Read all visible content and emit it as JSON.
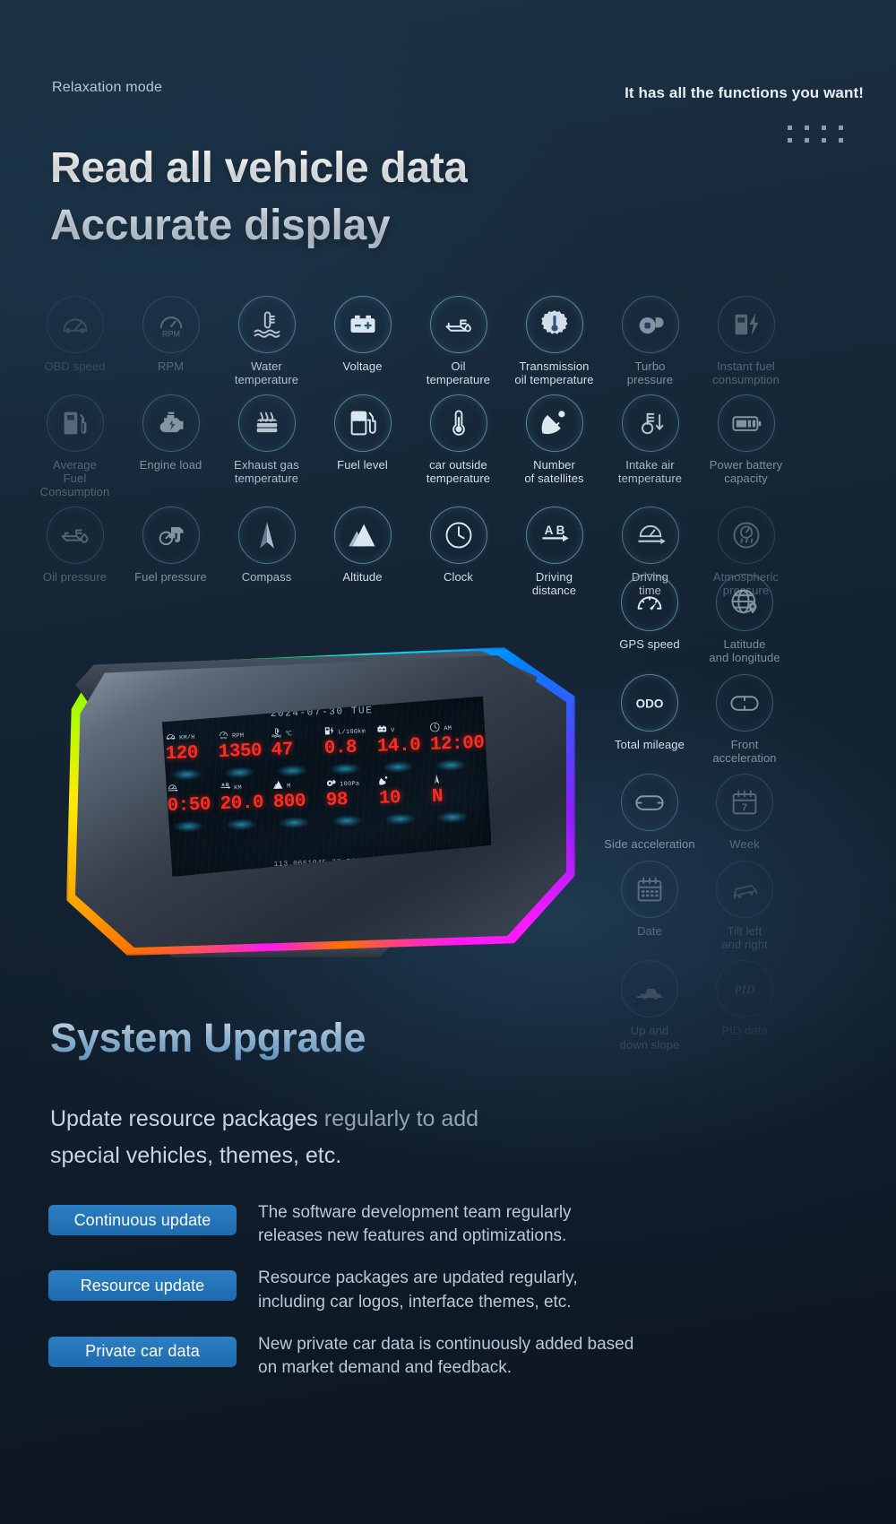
{
  "header": {
    "relaxation_mode": "Relaxation\nmode",
    "tagline": "It has all the functions you want!",
    "headline_line1": "Read all vehicle data",
    "headline_line2": "Accurate display"
  },
  "icon_grid": {
    "rows": [
      [
        {
          "label": "OBD speed",
          "icon": "speedometer-icon",
          "opacity": "op-16"
        },
        {
          "label": "RPM",
          "icon": "rpm-gauge-icon",
          "opacity": "op-30"
        },
        {
          "label": "Water\ntemperature",
          "icon": "water-temperature-icon",
          "opacity": "op-80"
        },
        {
          "label": "Voltage",
          "icon": "battery-voltage-icon",
          "opacity": "op-100"
        },
        {
          "label": "Oil\ntemperature",
          "icon": "oil-temperature-icon",
          "opacity": "op-100"
        },
        {
          "label": "Transmission\noil temperature",
          "icon": "transmission-oil-temperature-icon",
          "opacity": "op-100"
        },
        {
          "label": "Turbo\npressure",
          "icon": "turbo-pressure-icon",
          "opacity": "op-55"
        },
        {
          "label": "Instant fuel\nconsumption",
          "icon": "instant-fuel-consumption-icon",
          "opacity": "op-30"
        }
      ],
      [
        {
          "label": "Average\nFuel Consumption",
          "icon": "average-fuel-consumption-icon",
          "opacity": "op-30"
        },
        {
          "label": "Engine load",
          "icon": "engine-load-icon",
          "opacity": "op-55"
        },
        {
          "label": "Exhaust gas\ntemperature",
          "icon": "exhaust-gas-temperature-icon",
          "opacity": "op-80"
        },
        {
          "label": "Fuel level",
          "icon": "fuel-level-icon",
          "opacity": "op-100"
        },
        {
          "label": "car outside\ntemperature",
          "icon": "outside-temperature-icon",
          "opacity": "op-100"
        },
        {
          "label": "Number\nof satellites",
          "icon": "satellite-dish-icon",
          "opacity": "op-100"
        },
        {
          "label": "Intake air\ntemperature",
          "icon": "intake-air-temperature-icon",
          "opacity": "op-80"
        },
        {
          "label": "Power battery\ncapacity",
          "icon": "power-battery-capacity-icon",
          "opacity": "op-55"
        }
      ],
      [
        {
          "label": "Oil pressure",
          "icon": "oil-pressure-icon",
          "opacity": "op-30"
        },
        {
          "label": "Fuel pressure",
          "icon": "fuel-pressure-icon",
          "opacity": "op-55"
        },
        {
          "label": "Compass",
          "icon": "compass-icon",
          "opacity": "op-80"
        },
        {
          "label": "Altitude",
          "icon": "altitude-icon",
          "opacity": "op-100"
        },
        {
          "label": "Clock",
          "icon": "clock-icon",
          "opacity": "op-100"
        },
        {
          "label": "Driving\ndistance",
          "icon": "driving-distance-icon",
          "opacity": "op-100"
        },
        {
          "label": "Driving\ntime",
          "icon": "driving-time-icon",
          "opacity": "op-80"
        },
        {
          "label": "Atmospheric\npressure",
          "icon": "atmospheric-pressure-icon",
          "opacity": "op-30"
        }
      ]
    ]
  },
  "stair_column": {
    "rows": [
      [
        {
          "label": "GPS speed",
          "icon": "gps-speed-icon",
          "opacity": "op-100"
        },
        {
          "label": "Latitude\nand longitude",
          "icon": "latitude-longitude-icon",
          "opacity": "op-55"
        }
      ],
      [
        {
          "label": "Total mileage",
          "icon": "odometer-icon",
          "opacity": "op-100"
        },
        {
          "label": "Front\nacceleration",
          "icon": "front-acceleration-icon",
          "opacity": "op-55"
        }
      ],
      [
        {
          "label": "Side acceleration",
          "icon": "side-acceleration-icon",
          "opacity": "op-55"
        },
        {
          "label": "Week",
          "icon": "week-calendar-icon",
          "opacity": "op-30"
        }
      ],
      [
        {
          "label": "Date",
          "icon": "date-calendar-icon",
          "opacity": "op-30"
        },
        {
          "label": "Tilt left\nand right",
          "icon": "tilt-left-right-icon",
          "opacity": "op-16"
        }
      ],
      [
        {
          "label": "Up and\ndown slope",
          "icon": "up-down-slope-icon",
          "opacity": "op-16"
        },
        {
          "label": "PID data",
          "icon": "pid-data-icon",
          "opacity": "op-08"
        }
      ]
    ]
  },
  "device_screen": {
    "date": "2024-07-30  TUE",
    "cells": [
      {
        "icon": "speedometer-icon",
        "unit": "KM/H",
        "value": "120"
      },
      {
        "icon": "rpm-gauge-icon",
        "unit": "RPM",
        "value": "1350"
      },
      {
        "icon": "water-temperature-icon",
        "unit": "℃",
        "value": "47"
      },
      {
        "icon": "instant-fuel-consumption-icon",
        "unit": "L/100km",
        "value": "0.8"
      },
      {
        "icon": "battery-voltage-icon",
        "unit": "V",
        "value": "14.0"
      },
      {
        "icon": "clock-icon",
        "unit": "AM",
        "value": "12:00"
      },
      {
        "icon": "driving-time-icon",
        "unit": "",
        "value": "0:50"
      },
      {
        "icon": "driving-distance-icon",
        "unit": "KM",
        "value": "20.0"
      },
      {
        "icon": "altitude-icon",
        "unit": "M",
        "value": "800"
      },
      {
        "icon": "turbo-pressure-icon",
        "unit": "100Pa",
        "value": "98"
      },
      {
        "icon": "satellite-dish-icon",
        "unit": "",
        "value": "10"
      },
      {
        "icon": "compass-icon",
        "unit": "",
        "value": "N"
      }
    ],
    "coordinates": "113.066104E  22.599150N"
  },
  "system_upgrade": {
    "title": "System Upgrade",
    "subtitle_bright": "Update resource packages ",
    "subtitle_dim": "regularly to add",
    "subtitle_line2": "special vehicles, themes, etc.",
    "features": [
      {
        "badge": "Continuous update",
        "text": "The software development team regularly\nreleases new features and optimizations."
      },
      {
        "badge": "Resource update",
        "text": "Resource packages are updated regularly,\nincluding car logos, interface themes, etc."
      },
      {
        "badge": "Private car data",
        "text": "New private car data is continuously added based\non market demand and feedback."
      }
    ]
  },
  "colors": {
    "background": "#122130",
    "accent_blue": "#2b7fc4",
    "screen_red": "#ff2b22",
    "screen_cyan": "#32c8eb"
  }
}
